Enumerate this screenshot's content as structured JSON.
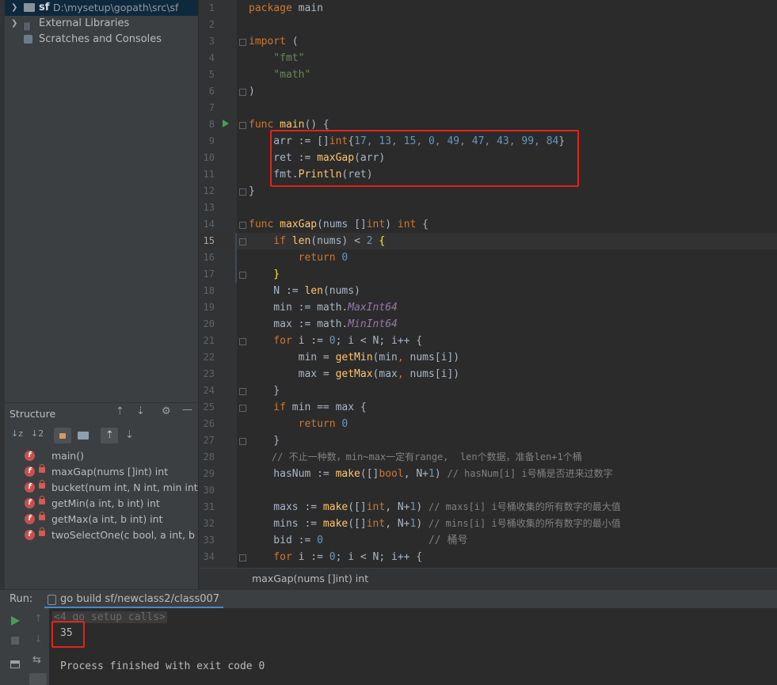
{
  "project": {
    "root_name": "sf",
    "root_path": "D:\\mysetup\\gopath\\src\\sf",
    "external_libraries": "External Libraries",
    "scratches": "Scratches and Consoles"
  },
  "structure": {
    "title": "Structure",
    "items": [
      "main()",
      "maxGap(nums []int) int",
      "bucket(num int, N int, min int, m",
      "getMin(a int, b int) int",
      "getMax(a int, b int) int",
      "twoSelectOne(c bool, a int, b int"
    ]
  },
  "editor": {
    "lines": [
      "1",
      "2",
      "3",
      "4",
      "5",
      "6",
      "7",
      "8",
      "9",
      "10",
      "11",
      "12",
      "13",
      "14",
      "15",
      "16",
      "17",
      "18",
      "19",
      "20",
      "21",
      "22",
      "23",
      "24",
      "25",
      "26",
      "27",
      "28",
      "29",
      "30",
      "31",
      "32",
      "33",
      "34"
    ],
    "breadcrumb": "maxGap(nums []int) int",
    "code": {
      "l1a": "package",
      "l1b": " main",
      "l3a": "import",
      "l3b": " (",
      "l4": "    \"fmt\"",
      "l5": "    \"math\"",
      "l6": ")",
      "l8a": "func",
      "l8b": " main",
      "l8c": "() {",
      "l9a": "    arr := []",
      "l9b": "int",
      "l9c": "{",
      "l9d": "17, 13, 15, 0, 49, 47, 43, 99, 84",
      "l9e": "}",
      "l10a": "    ret := ",
      "l10b": "maxGap",
      "l10c": "(arr)",
      "l11a": "    fmt.",
      "l11b": "Println",
      "l11c": "(ret)",
      "l12": "}",
      "l14a": "func",
      "l14b": " maxGap",
      "l14c": "(nums []",
      "l14d": "int",
      "l14e": ") ",
      "l14f": "int",
      "l14g": " {",
      "l15a": "    if ",
      "l15b": "len",
      "l15c": "(nums) < ",
      "l15d": "2",
      "l15e": " {",
      "l16a": "        return ",
      "l16b": "0",
      "l17": "    }",
      "l18a": "    N := ",
      "l18b": "len",
      "l18c": "(nums)",
      "l19a": "    min := math.",
      "l19b": "MaxInt64",
      "l20a": "    max := math.",
      "l20b": "MinInt64",
      "l21a": "    for",
      "l21b": " i := ",
      "l21c": "0",
      "l21d": "; i < N; i++ {",
      "l22a": "        min = ",
      "l22b": "getMin",
      "l22c": "(min",
      "l22d": ", ",
      "l22e": "nums[i])",
      "l23a": "        max = ",
      "l23b": "getMax",
      "l23c": "(max",
      "l23d": ", ",
      "l23e": "nums[i])",
      "l24": "    }",
      "l25a": "    if",
      "l25b": " min == max {",
      "l26a": "        return ",
      "l26b": "0",
      "l27": "    }",
      "l28": "    // 不止一种数，min~max一定有range,  len个数据，准备len+1个桶",
      "l29a": "    hasNum := ",
      "l29b": "make",
      "l29c": "([]",
      "l29d": "bool",
      "l29e": ", N+",
      "l29f": "1",
      "l29g": ") ",
      "l29h": "// hasNum[i] i号桶是否进来过数字",
      "l31a": "    maxs := ",
      "l31b": "make",
      "l31c": "([]",
      "l31d": "int",
      "l31e": ", N+",
      "l31f": "1",
      "l31g": ") ",
      "l31h": "// maxs[i] i号桶收集的所有数字的最大值",
      "l32a": "    mins := ",
      "l32b": "make",
      "l32c": "([]",
      "l32d": "int",
      "l32e": ", N+",
      "l32f": "1",
      "l32g": ") ",
      "l32h": "// mins[i] i号桶收集的所有数字的最小值",
      "l33a": "    bid := ",
      "l33b": "0",
      "l33c": "                 ",
      "l33d": "// 桶号",
      "l34a": "    for",
      "l34b": " i := ",
      "l34c": "0",
      "l34d": "; i < N; i++ {"
    }
  },
  "run": {
    "label": "Run:",
    "tab": "go build sf/newclass2/class007",
    "setup_calls": "<4 go setup calls>",
    "output_value": "35",
    "finished": "Process finished with exit code 0"
  }
}
